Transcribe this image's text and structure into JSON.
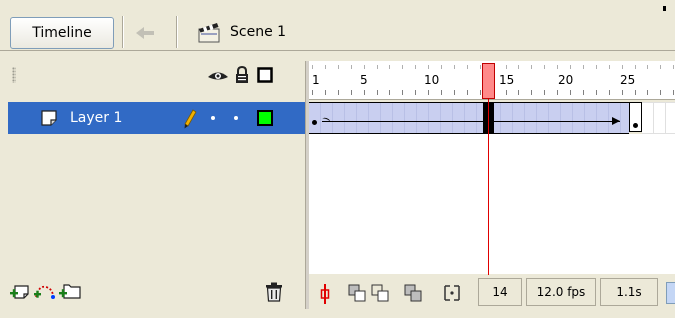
{
  "toolbar": {
    "timeline_button": "Timeline",
    "scene_label": "Scene 1"
  },
  "layers": [
    {
      "name": "Layer 1",
      "selected": true,
      "visible": true,
      "locked": false,
      "outline_color": "#00ff00"
    }
  ],
  "ruler": {
    "labels": [
      "1",
      "5",
      "10",
      "15",
      "20",
      "25"
    ]
  },
  "playhead": {
    "current_frame": 14
  },
  "status": {
    "current_frame": "14",
    "frame_rate": "12.0 fps",
    "elapsed_time": "1.1s"
  },
  "icons": {
    "eye": "eye-icon",
    "lock": "lock-icon",
    "outline": "outline-square-icon",
    "pencil": "pencil-icon",
    "add_layer": "insert-layer-icon",
    "add_guide": "add-motion-guide-icon",
    "add_folder": "insert-folder-icon",
    "trash": "trash-icon"
  },
  "colors": {
    "selection": "#316ac5",
    "tween_frames": "#c9cff0",
    "playhead": "#ff8a8a",
    "outline_square": "#00ff00"
  }
}
